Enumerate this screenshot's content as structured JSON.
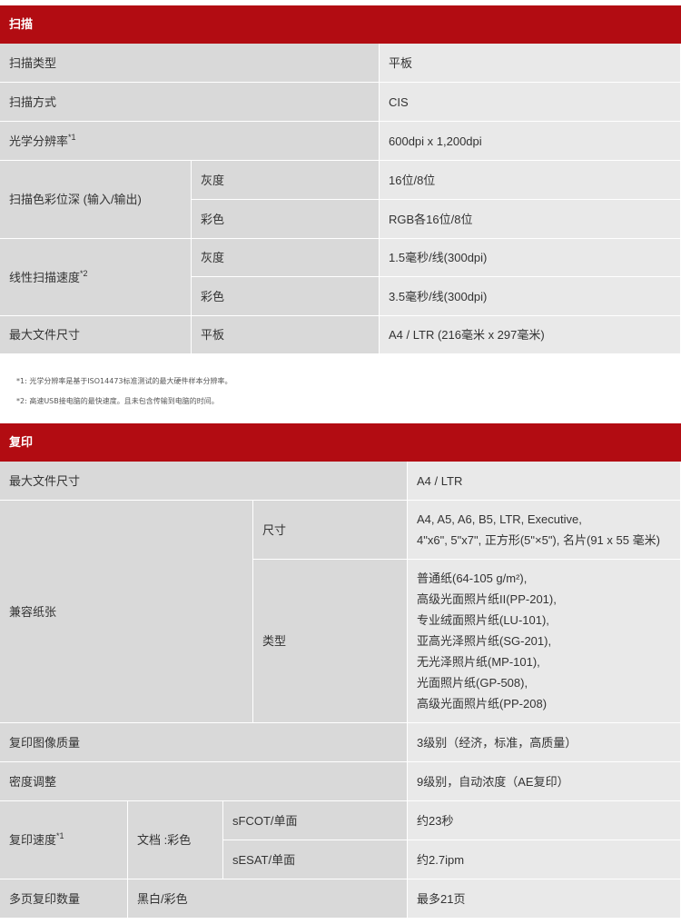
{
  "scan": {
    "title": "扫描",
    "type_label": "扫描类型",
    "type_value": "平板",
    "method_label": "扫描方式",
    "method_value": "CIS",
    "resolution_label": "光学分辨率",
    "resolution_sup": "*1",
    "resolution_value": "600dpi x 1,200dpi",
    "depth_label": "扫描色彩位深 (输入/输出)",
    "depth_gray_label": "灰度",
    "depth_gray_value": "16位/8位",
    "depth_color_label": "彩色",
    "depth_color_value": "RGB各16位/8位",
    "speed_label": "线性扫描速度",
    "speed_sup": "*2",
    "speed_gray_label": "灰度",
    "speed_gray_value": "1.5毫秒/线(300dpi)",
    "speed_color_label": "彩色",
    "speed_color_value": "3.5毫秒/线(300dpi)",
    "maxdoc_label": "最大文件尺寸",
    "maxdoc_sub": "平板",
    "maxdoc_value": "A4 / LTR (216毫米 x 297毫米)",
    "note1": "*1: 光学分辨率是基于ISO14473标准测试的最大硬件样本分辨率。",
    "note2": "*2: 高速USB接电脑的最快速度。且未包含传输到电脑的时间。"
  },
  "copy": {
    "title": "复印",
    "maxdoc_label": "最大文件尺寸",
    "maxdoc_value": "A4 / LTR",
    "paper_label": "兼容纸张",
    "size_label": "尺寸",
    "size_lines": [
      "A4, A5, A6, B5, LTR, Executive,",
      "4\"x6\", 5\"x7\", 正方形(5\"×5\"), 名片(91 x 55 毫米)"
    ],
    "type_label": "类型",
    "type_lines": [
      "普通纸(64-105 g/m²),",
      "高级光面照片纸II(PP-201),",
      "专业绒面照片纸(LU-101),",
      "亚高光泽照片纸(SG-201),",
      "无光泽照片纸(MP-101),",
      "光面照片纸(GP-508),",
      "高级光面照片纸(PP-208)"
    ],
    "quality_label": "复印图像质量",
    "quality_value": "3级别（经济，标准，高质量）",
    "density_label": "密度调整",
    "density_value": "9级别，自动浓度（AE复印）",
    "speed_label": "复印速度",
    "speed_sup": "*1",
    "speed_doc_label": "文档 :彩色",
    "sfcot_label": "sFCOT/单面",
    "sfcot_value": "约23秒",
    "sesat_label": "sESAT/单面",
    "sesat_value": "约2.7ipm",
    "multi_label": "多页复印数量",
    "multi_sub": "黑白/彩色",
    "multi_value": "最多21页"
  }
}
